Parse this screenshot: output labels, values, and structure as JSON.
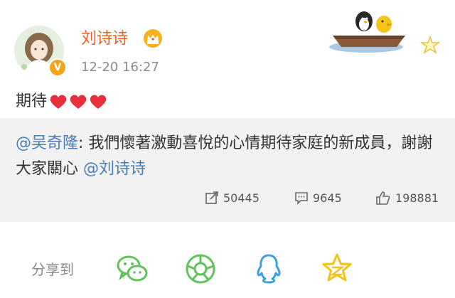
{
  "post": {
    "username": "刘诗诗",
    "timestamp": "12-20 16:27",
    "text": "期待"
  },
  "repost": {
    "mention_author": "@吴奇隆",
    "body": ": 我們懷著激動喜悅的心情期待家庭的新成員，謝謝大家關心 ",
    "mention_tail": "@刘诗诗"
  },
  "stats": {
    "reposts": "50445",
    "comments": "9645",
    "likes": "198881"
  },
  "share": {
    "label": "分享到",
    "targets": [
      "wechat-icon",
      "wechat-moments-icon",
      "qq-icon",
      "qzone-icon"
    ]
  },
  "colors": {
    "username": "#e8602a",
    "mention": "#4a7ab8",
    "heart": "#e8313f",
    "repost_bg": "#f2f2f2",
    "share_green": "#5fc35b",
    "share_blue": "#3fa0dc",
    "share_yellow": "#f2c21b"
  }
}
